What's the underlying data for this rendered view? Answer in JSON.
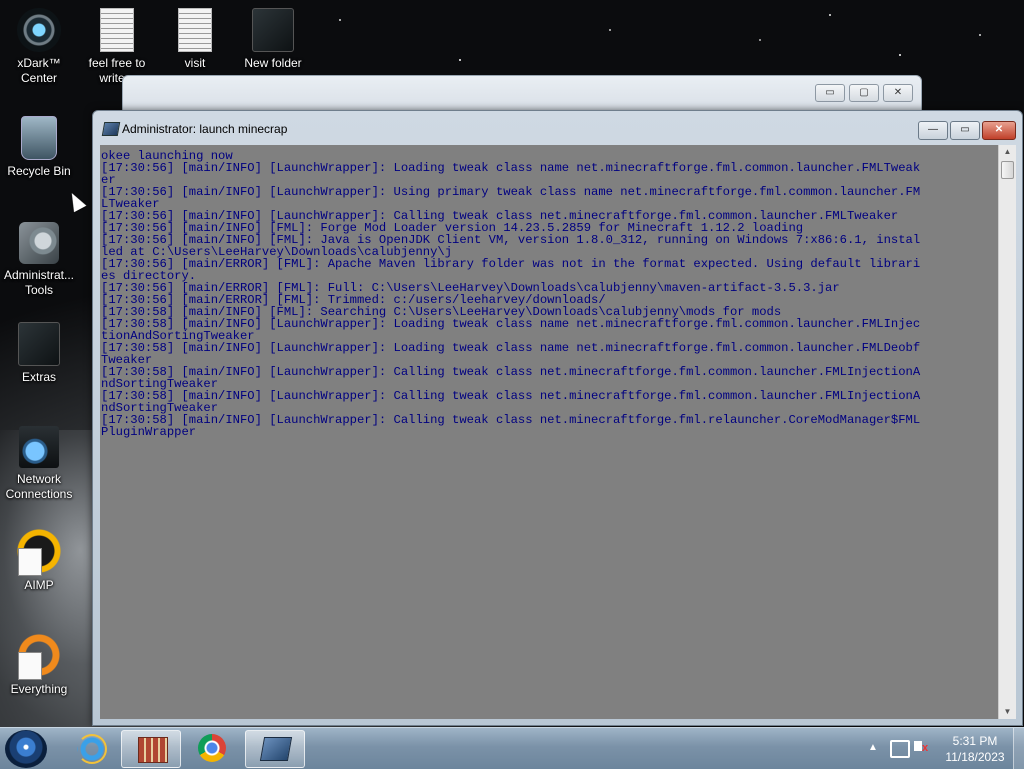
{
  "desktop": {
    "icons": [
      {
        "label": "xDark™\nCenter"
      },
      {
        "label": "feel free to\nwrite a"
      },
      {
        "label": "visit"
      },
      {
        "label": "New folder"
      },
      {
        "label": "Recycle Bin"
      },
      {
        "label": "Administrat...\nTools"
      },
      {
        "label": "Extras"
      },
      {
        "label": "Network\nConnections"
      },
      {
        "label": "AIMP"
      },
      {
        "label": "Everything"
      }
    ]
  },
  "background_window": {
    "min": "▭",
    "max": "▢",
    "close": "✕"
  },
  "console_window": {
    "title": "Administrator:  launch minecrap",
    "buttons": {
      "min": "—",
      "max": "▭",
      "close": "✕"
    },
    "text": "okee launching now\n[17:30:56] [main/INFO] [LaunchWrapper]: Loading tweak class name net.minecraftforge.fml.common.launcher.FMLTweak\ner\n[17:30:56] [main/INFO] [LaunchWrapper]: Using primary tweak class name net.minecraftforge.fml.common.launcher.FM\nLTweaker\n[17:30:56] [main/INFO] [LaunchWrapper]: Calling tweak class net.minecraftforge.fml.common.launcher.FMLTweaker\n[17:30:56] [main/INFO] [FML]: Forge Mod Loader version 14.23.5.2859 for Minecraft 1.12.2 loading\n[17:30:56] [main/INFO] [FML]: Java is OpenJDK Client VM, version 1.8.0_312, running on Windows 7:x86:6.1, instal\nled at C:\\Users\\LeeHarvey\\Downloads\\calubjenny\\j\n[17:30:56] [main/ERROR] [FML]: Apache Maven library folder was not in the format expected. Using default librari\nes directory.\n[17:30:56] [main/ERROR] [FML]: Full: C:\\Users\\LeeHarvey\\Downloads\\calubjenny\\maven-artifact-3.5.3.jar\n[17:30:56] [main/ERROR] [FML]: Trimmed: c:/users/leeharvey/downloads/\n[17:30:58] [main/INFO] [FML]: Searching C:\\Users\\LeeHarvey\\Downloads\\calubjenny\\mods for mods\n[17:30:58] [main/INFO] [LaunchWrapper]: Loading tweak class name net.minecraftforge.fml.common.launcher.FMLInjec\ntionAndSortingTweaker\n[17:30:58] [main/INFO] [LaunchWrapper]: Loading tweak class name net.minecraftforge.fml.common.launcher.FMLDeobf\nTweaker\n[17:30:58] [main/INFO] [LaunchWrapper]: Calling tweak class net.minecraftforge.fml.common.launcher.FMLInjectionA\nndSortingTweaker\n[17:30:58] [main/INFO] [LaunchWrapper]: Calling tweak class net.minecraftforge.fml.common.launcher.FMLInjectionA\nndSortingTweaker\n[17:30:58] [main/INFO] [LaunchWrapper]: Calling tweak class net.minecraftforge.fml.relauncher.CoreModManager$FML\nPluginWrapper",
    "scroll_up": "▲",
    "scroll_down": "▼"
  },
  "taskbar": {
    "tray_arrow": "▲",
    "clock_time": "5:31 PM",
    "clock_date": "11/18/2023"
  },
  "colors": {
    "console_bg": "#808080",
    "console_fg": "#000080"
  }
}
